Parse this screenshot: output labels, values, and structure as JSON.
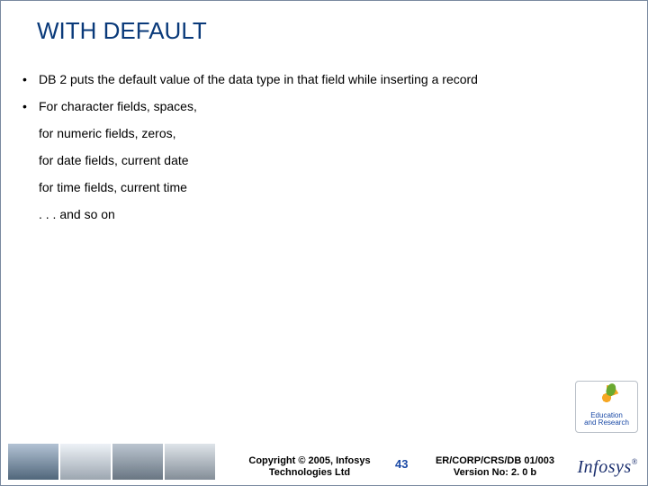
{
  "title": "WITH DEFAULT",
  "bullets": [
    "DB 2 puts the default value of the data type in that field while inserting a record",
    "For character fields, spaces,"
  ],
  "sublines": [
    "for numeric fields, zeros,",
    "for date fields, current date",
    "for time fields, current time",
    ". . . and so on"
  ],
  "footer": {
    "copyright_line1": "Copyright © 2005, Infosys",
    "copyright_line2": "Technologies Ltd",
    "page_number": "43",
    "docref_line1": "ER/CORP/CRS/DB 01/003",
    "docref_line2": "Version No: 2. 0 b",
    "logo_text": "Infosys",
    "logo_reg": "®",
    "badge_line1": "Education",
    "badge_line2": "and Research"
  }
}
